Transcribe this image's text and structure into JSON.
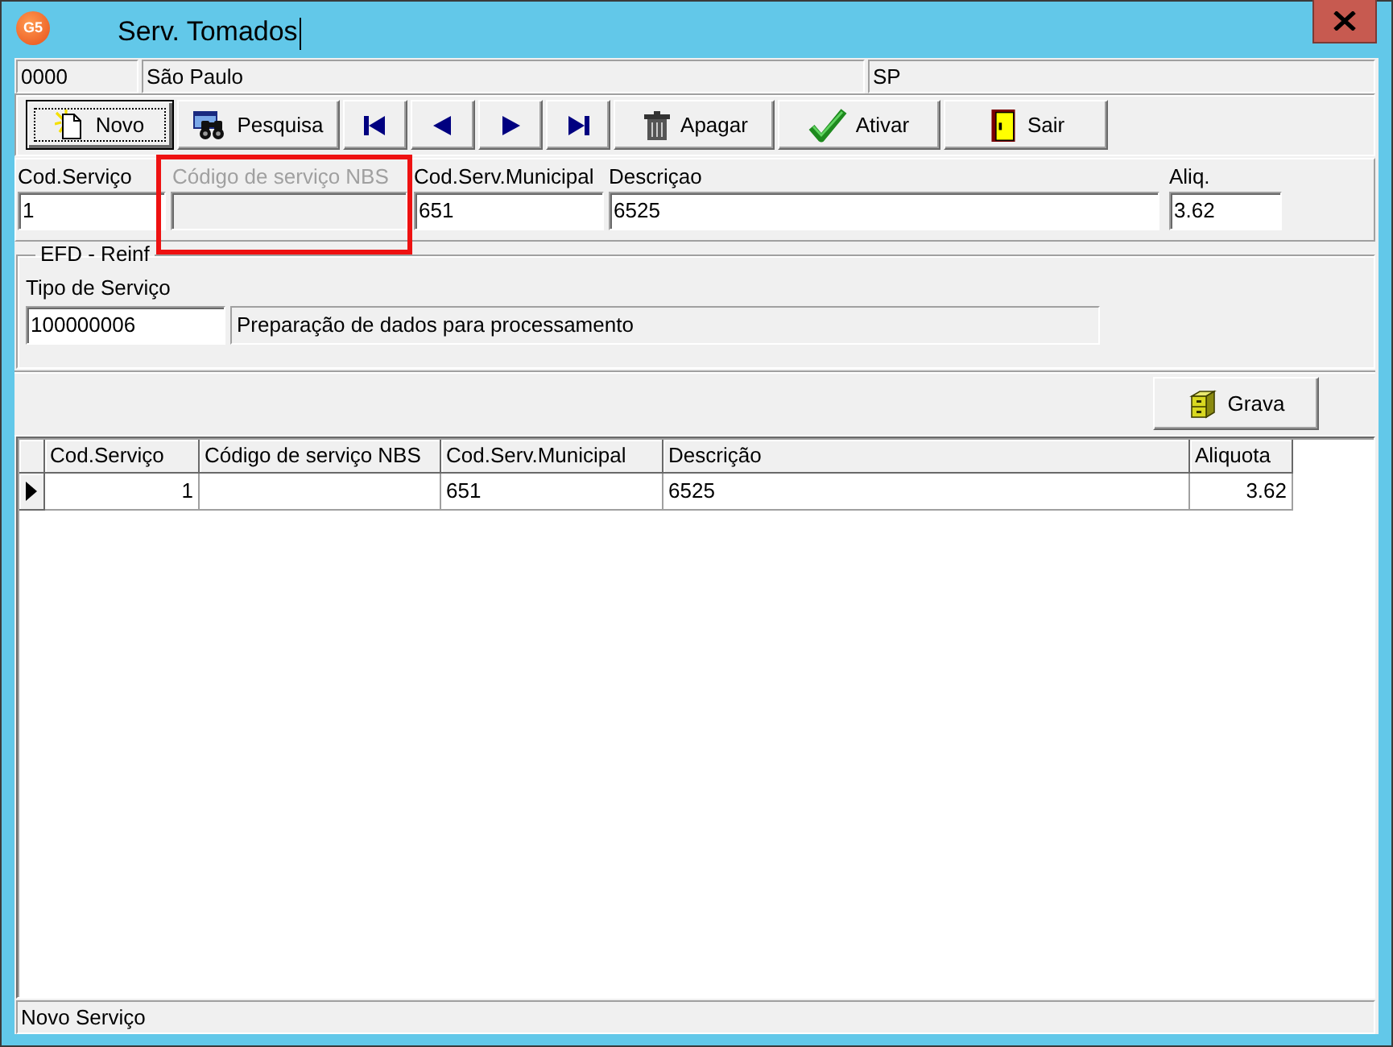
{
  "window": {
    "logo": "G5",
    "title": "Serv. Tomados",
    "caret_visible": true
  },
  "header": {
    "company_code": "0000",
    "city": "São Paulo",
    "state": "SP"
  },
  "toolbar": {
    "buttons": [
      {
        "label": "Novo",
        "focused": true
      },
      {
        "label": "Pesquisa",
        "focused": false
      },
      {
        "focused": false
      },
      {
        "focused": false
      },
      {
        "focused": false
      },
      {
        "focused": false
      },
      {
        "label": "Apagar",
        "focused": false
      },
      {
        "label": "Ativar",
        "focused": false
      },
      {
        "label": "Sair",
        "focused": false
      }
    ]
  },
  "form": {
    "fields": [
      {
        "label": "Cod.Serviço",
        "value": "1",
        "disabled": false,
        "highlighted": false
      },
      {
        "label": "Código de serviço NBS",
        "disabled": true,
        "highlighted": true
      },
      {
        "label": "Cod.Serv.Municipal",
        "value": "651",
        "disabled": false,
        "highlighted": false
      },
      {
        "label": "Descriçao",
        "value": "6525",
        "disabled": false,
        "highlighted": false
      },
      {
        "label": "Aliq.",
        "value": "3.62",
        "disabled": false,
        "highlighted": false
      }
    ]
  },
  "efd": {
    "legend": "EFD - Reinf",
    "label": "Tipo de Serviço",
    "code": "100000006",
    "description": "Preparação de dados para processamento"
  },
  "save_button": {
    "label": "Grava"
  },
  "grid": {
    "columns": [
      {
        "label": "Cod.Serviço",
        "kind": "number"
      },
      {
        "label": "Código de serviço NBS",
        "kind": "text"
      },
      {
        "label": "Cod.Serv.Municipal",
        "kind": "text"
      },
      {
        "label": "Descrição",
        "kind": "text"
      },
      {
        "label": "Aliquota",
        "kind": "number"
      }
    ],
    "rows": [
      {
        "selected": true,
        "cells": [
          "1",
          null,
          "651",
          "6525",
          "3.62"
        ]
      }
    ]
  },
  "status_bar": {
    "text": "Novo Serviço"
  }
}
